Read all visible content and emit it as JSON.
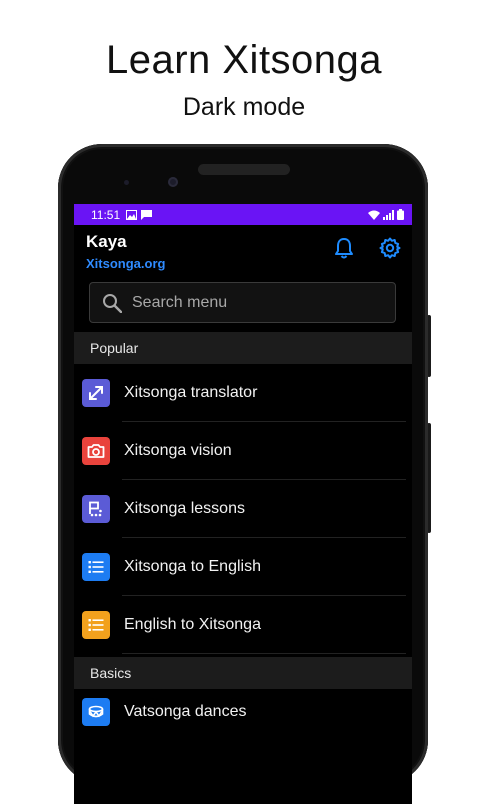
{
  "promo": {
    "title": "Learn Xitsonga",
    "subtitle": "Dark mode"
  },
  "status_bar": {
    "time": "11:51"
  },
  "header": {
    "app_name": "Kaya",
    "site": "Xitsonga.org",
    "icons": [
      "bell-icon",
      "gear-icon"
    ]
  },
  "search": {
    "placeholder": "Search menu",
    "icon": "search-icon"
  },
  "sections": [
    {
      "label": "Popular",
      "items": [
        {
          "label": "Xitsonga translator",
          "icon": "translate-arrows-icon",
          "color": "#5b5bd6"
        },
        {
          "label": "Xitsonga vision",
          "icon": "camera-icon",
          "color": "#e9433c"
        },
        {
          "label": "Xitsonga lessons",
          "icon": "lessons-icon",
          "color": "#5b5bd6"
        },
        {
          "label": "Xitsonga to English",
          "icon": "list-icon",
          "color": "#1d7cf2"
        },
        {
          "label": "English to Xitsonga",
          "icon": "list-icon",
          "color": "#f2a11d"
        }
      ]
    },
    {
      "label": "Basics",
      "items": [
        {
          "label": "Vatsonga dances",
          "icon": "drum-icon",
          "color": "#1d7cf2"
        }
      ]
    }
  ],
  "colors": {
    "status_bar": "#6a14f5",
    "accent": "#2f8bff",
    "background": "#000000"
  }
}
